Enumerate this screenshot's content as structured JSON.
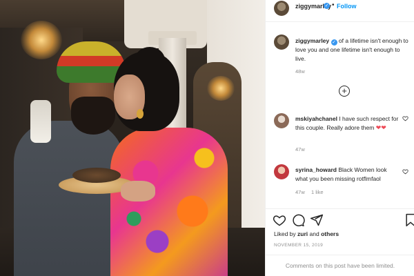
{
  "post": {
    "username": "ziggymarley",
    "verified_badge": "✓",
    "separator": "•",
    "follow_label": "Follow",
    "caption_text": "of a lifetime isn't enough to love you and one lifetime isn't enough to live.",
    "caption_age": "48w"
  },
  "load_more_icon": "+",
  "comments": [
    {
      "username": "mskiyahchanel",
      "text": "I have such respect for this couple. Really adore them",
      "emoji": "❤❤",
      "age": "47w",
      "likes": ""
    },
    {
      "username": "syrina_howard",
      "text": "Black Women look what you been missing rotflmfaol",
      "emoji": "",
      "age": "47w",
      "likes": "1 like"
    }
  ],
  "actions": {
    "liked_by_prefix": "Liked by",
    "liked_by_user": "zuri",
    "liked_by_suffix": "and",
    "liked_by_others": "others",
    "date": "NOVEMBER 15, 2019",
    "limited_notice": "Comments on this post have been limited."
  },
  "icons": {
    "heart": "heart-icon",
    "comment": "comment-icon",
    "share": "share-icon",
    "save": "bookmark-icon",
    "add": "plus-circle-icon"
  }
}
